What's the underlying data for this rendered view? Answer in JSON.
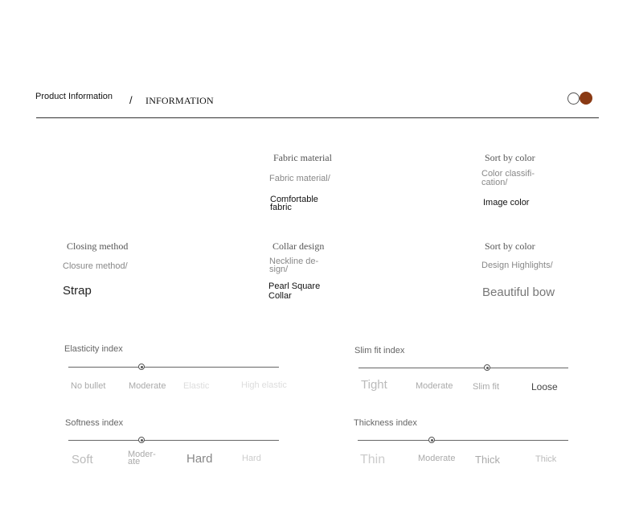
{
  "header": {
    "title": "Product Information",
    "separator": "/",
    "subtitle": "INFORMATION",
    "colors": {
      "swatch_outline": "#ffffff",
      "swatch_fill": "#8a3a14",
      "rule": "#333333"
    }
  },
  "attributes": {
    "fabric": {
      "heading": "Fabric material",
      "label": "Fabric material/",
      "value_line1": "Comfortable",
      "value_line2": "fabric"
    },
    "color": {
      "heading": "Sort by color",
      "label_line1": "Color classifi-",
      "label_line2": "cation/",
      "value": "Image color"
    },
    "closing": {
      "heading": "Closing method",
      "label": "Closure method/",
      "value": "Strap"
    },
    "collar": {
      "heading": "Collar design",
      "label_line1": "Neckline de-",
      "label_line2": "sign/",
      "value_line1": "Pearl Square",
      "value_line2": "Collar"
    },
    "highlights": {
      "heading": "Sort by color",
      "label": "Design Highlights/",
      "value": "Beautiful bow"
    }
  },
  "indices": {
    "elasticity": {
      "title": "Elasticity index",
      "level": 0.35,
      "ticks": [
        "No bullet",
        "Moderate",
        "Elastic",
        "High elastic"
      ]
    },
    "slim_fit": {
      "title": "Slim fit index",
      "level": 0.61,
      "ticks": [
        "Tight",
        "Moderate",
        "Slim fit",
        "Loose"
      ]
    },
    "softness": {
      "title": "Softness index",
      "level": 0.35,
      "ticks": [
        "Soft",
        "Moder-",
        "ate",
        "Hard",
        "Hard"
      ]
    },
    "thickness": {
      "title": "Thickness index",
      "level": 0.35,
      "ticks": [
        "Thin",
        "Moderate",
        "Thick",
        "Thick"
      ]
    }
  }
}
